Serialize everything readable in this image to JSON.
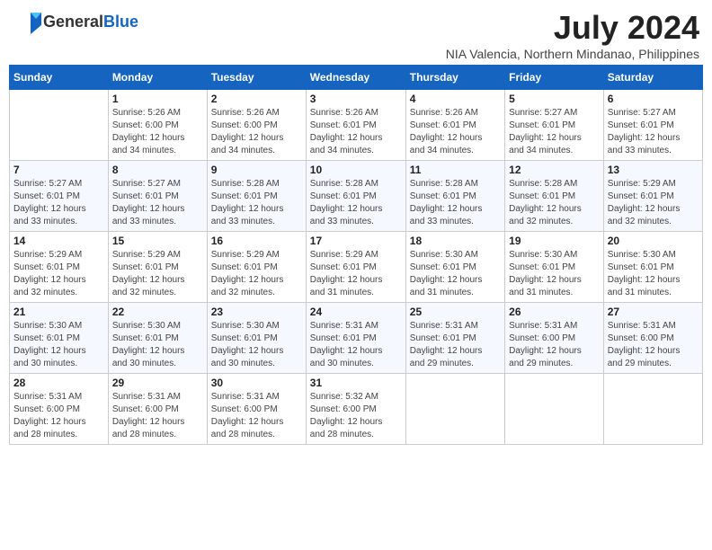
{
  "logo": {
    "general": "General",
    "blue": "Blue"
  },
  "title": {
    "month": "July 2024",
    "location": "NIA Valencia, Northern Mindanao, Philippines"
  },
  "headers": [
    "Sunday",
    "Monday",
    "Tuesday",
    "Wednesday",
    "Thursday",
    "Friday",
    "Saturday"
  ],
  "weeks": [
    [
      {
        "day": "",
        "info": ""
      },
      {
        "day": "1",
        "info": "Sunrise: 5:26 AM\nSunset: 6:00 PM\nDaylight: 12 hours\nand 34 minutes."
      },
      {
        "day": "2",
        "info": "Sunrise: 5:26 AM\nSunset: 6:00 PM\nDaylight: 12 hours\nand 34 minutes."
      },
      {
        "day": "3",
        "info": "Sunrise: 5:26 AM\nSunset: 6:01 PM\nDaylight: 12 hours\nand 34 minutes."
      },
      {
        "day": "4",
        "info": "Sunrise: 5:26 AM\nSunset: 6:01 PM\nDaylight: 12 hours\nand 34 minutes."
      },
      {
        "day": "5",
        "info": "Sunrise: 5:27 AM\nSunset: 6:01 PM\nDaylight: 12 hours\nand 34 minutes."
      },
      {
        "day": "6",
        "info": "Sunrise: 5:27 AM\nSunset: 6:01 PM\nDaylight: 12 hours\nand 33 minutes."
      }
    ],
    [
      {
        "day": "7",
        "info": "Sunrise: 5:27 AM\nSunset: 6:01 PM\nDaylight: 12 hours\nand 33 minutes."
      },
      {
        "day": "8",
        "info": "Sunrise: 5:27 AM\nSunset: 6:01 PM\nDaylight: 12 hours\nand 33 minutes."
      },
      {
        "day": "9",
        "info": "Sunrise: 5:28 AM\nSunset: 6:01 PM\nDaylight: 12 hours\nand 33 minutes."
      },
      {
        "day": "10",
        "info": "Sunrise: 5:28 AM\nSunset: 6:01 PM\nDaylight: 12 hours\nand 33 minutes."
      },
      {
        "day": "11",
        "info": "Sunrise: 5:28 AM\nSunset: 6:01 PM\nDaylight: 12 hours\nand 33 minutes."
      },
      {
        "day": "12",
        "info": "Sunrise: 5:28 AM\nSunset: 6:01 PM\nDaylight: 12 hours\nand 32 minutes."
      },
      {
        "day": "13",
        "info": "Sunrise: 5:29 AM\nSunset: 6:01 PM\nDaylight: 12 hours\nand 32 minutes."
      }
    ],
    [
      {
        "day": "14",
        "info": "Sunrise: 5:29 AM\nSunset: 6:01 PM\nDaylight: 12 hours\nand 32 minutes."
      },
      {
        "day": "15",
        "info": "Sunrise: 5:29 AM\nSunset: 6:01 PM\nDaylight: 12 hours\nand 32 minutes."
      },
      {
        "day": "16",
        "info": "Sunrise: 5:29 AM\nSunset: 6:01 PM\nDaylight: 12 hours\nand 32 minutes."
      },
      {
        "day": "17",
        "info": "Sunrise: 5:29 AM\nSunset: 6:01 PM\nDaylight: 12 hours\nand 31 minutes."
      },
      {
        "day": "18",
        "info": "Sunrise: 5:30 AM\nSunset: 6:01 PM\nDaylight: 12 hours\nand 31 minutes."
      },
      {
        "day": "19",
        "info": "Sunrise: 5:30 AM\nSunset: 6:01 PM\nDaylight: 12 hours\nand 31 minutes."
      },
      {
        "day": "20",
        "info": "Sunrise: 5:30 AM\nSunset: 6:01 PM\nDaylight: 12 hours\nand 31 minutes."
      }
    ],
    [
      {
        "day": "21",
        "info": "Sunrise: 5:30 AM\nSunset: 6:01 PM\nDaylight: 12 hours\nand 30 minutes."
      },
      {
        "day": "22",
        "info": "Sunrise: 5:30 AM\nSunset: 6:01 PM\nDaylight: 12 hours\nand 30 minutes."
      },
      {
        "day": "23",
        "info": "Sunrise: 5:30 AM\nSunset: 6:01 PM\nDaylight: 12 hours\nand 30 minutes."
      },
      {
        "day": "24",
        "info": "Sunrise: 5:31 AM\nSunset: 6:01 PM\nDaylight: 12 hours\nand 30 minutes."
      },
      {
        "day": "25",
        "info": "Sunrise: 5:31 AM\nSunset: 6:01 PM\nDaylight: 12 hours\nand 29 minutes."
      },
      {
        "day": "26",
        "info": "Sunrise: 5:31 AM\nSunset: 6:00 PM\nDaylight: 12 hours\nand 29 minutes."
      },
      {
        "day": "27",
        "info": "Sunrise: 5:31 AM\nSunset: 6:00 PM\nDaylight: 12 hours\nand 29 minutes."
      }
    ],
    [
      {
        "day": "28",
        "info": "Sunrise: 5:31 AM\nSunset: 6:00 PM\nDaylight: 12 hours\nand 28 minutes."
      },
      {
        "day": "29",
        "info": "Sunrise: 5:31 AM\nSunset: 6:00 PM\nDaylight: 12 hours\nand 28 minutes."
      },
      {
        "day": "30",
        "info": "Sunrise: 5:31 AM\nSunset: 6:00 PM\nDaylight: 12 hours\nand 28 minutes."
      },
      {
        "day": "31",
        "info": "Sunrise: 5:32 AM\nSunset: 6:00 PM\nDaylight: 12 hours\nand 28 minutes."
      },
      {
        "day": "",
        "info": ""
      },
      {
        "day": "",
        "info": ""
      },
      {
        "day": "",
        "info": ""
      }
    ]
  ]
}
